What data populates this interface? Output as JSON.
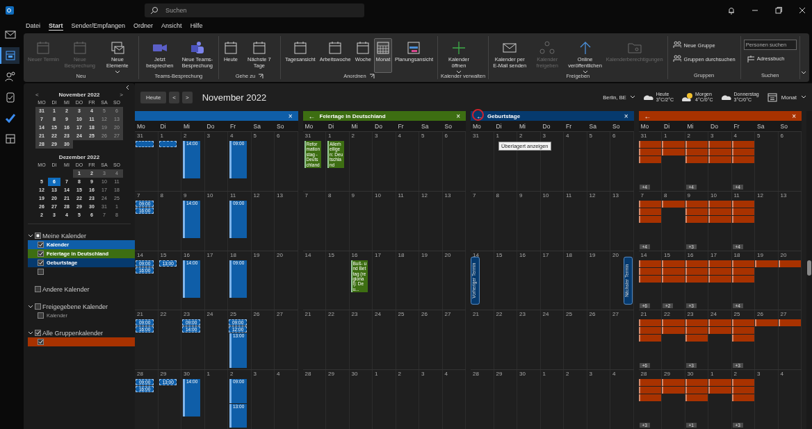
{
  "app_rail": {
    "items": [
      {
        "selected": false
      },
      {
        "selected": true
      },
      {
        "selected": false
      },
      {
        "selected": false
      },
      {
        "selected": false
      },
      {
        "selected": false
      }
    ]
  },
  "title_bar": {
    "search_placeholder": "Suchen"
  },
  "menu_tabs": [
    {
      "label": "Datei",
      "selected": false
    },
    {
      "label": "Start",
      "selected": true
    },
    {
      "label": "Sender/Empfangen",
      "selected": false
    },
    {
      "label": "Ordner",
      "selected": false
    },
    {
      "label": "Ansicht",
      "selected": false
    },
    {
      "label": "Hilfe",
      "selected": false
    }
  ],
  "ribbon": {
    "groups": [
      {
        "label": "Neu",
        "launcher": false,
        "buttons": [
          {
            "kind": "large",
            "label": "Neuer Termin",
            "disabled": true,
            "selected": false,
            "dropdown": false
          },
          {
            "kind": "large",
            "label": "Neue Besprechung",
            "disabled": true,
            "selected": false,
            "dropdown": false
          },
          {
            "kind": "large",
            "label": "Neue Elemente",
            "disabled": false,
            "selected": false,
            "dropdown": true
          }
        ]
      },
      {
        "label": "Teams-Besprechung",
        "launcher": false,
        "buttons": [
          {
            "kind": "large",
            "label": "Jetzt besprechen",
            "disabled": false,
            "selected": false,
            "dropdown": false
          },
          {
            "kind": "large",
            "label": "Neue Teams-Besprechung",
            "disabled": false,
            "selected": false,
            "dropdown": false
          }
        ]
      },
      {
        "label": "Gehe zu",
        "launcher": true,
        "buttons": [
          {
            "kind": "large",
            "label": "Heute",
            "disabled": false,
            "selected": false,
            "dropdown": false
          },
          {
            "kind": "large",
            "label": "Nächste 7 Tage",
            "disabled": false,
            "selected": false,
            "dropdown": false
          }
        ]
      },
      {
        "label": "Anordnen",
        "launcher": true,
        "buttons": [
          {
            "kind": "large",
            "label": "Tagesansicht",
            "disabled": false,
            "selected": false,
            "dropdown": false
          },
          {
            "kind": "large",
            "label": "Arbeitswoche",
            "disabled": false,
            "selected": false,
            "dropdown": false
          },
          {
            "kind": "large",
            "label": "Woche",
            "disabled": false,
            "selected": false,
            "dropdown": false
          },
          {
            "kind": "large",
            "label": "Monat",
            "disabled": false,
            "selected": true,
            "dropdown": false
          },
          {
            "kind": "large",
            "label": "Planungsansicht",
            "disabled": false,
            "selected": false,
            "dropdown": false
          }
        ]
      },
      {
        "label": "Kalender verwalten",
        "launcher": false,
        "buttons": [
          {
            "kind": "large",
            "label": "Kalender öffnen",
            "disabled": false,
            "selected": false,
            "dropdown": true
          }
        ]
      },
      {
        "label": "Freigeben",
        "launcher": false,
        "buttons": [
          {
            "kind": "large",
            "label": "Kalender per E-Mail senden",
            "disabled": false,
            "selected": false,
            "dropdown": false
          },
          {
            "kind": "large",
            "label": "Kalender freigeben",
            "disabled": true,
            "selected": false,
            "dropdown": false
          },
          {
            "kind": "large",
            "label": "Online veröffentlichen",
            "disabled": false,
            "selected": false,
            "dropdown": true
          },
          {
            "kind": "large",
            "label": "Kalenderberechtigungen",
            "disabled": true,
            "selected": false,
            "dropdown": false
          }
        ]
      },
      {
        "label": "Gruppen",
        "launcher": false,
        "buttons": [
          {
            "kind": "small",
            "label": "Neue Gruppe",
            "disabled": false,
            "selected": false,
            "dropdown": false
          },
          {
            "kind": "small",
            "label": "Gruppen durchsuchen",
            "disabled": false,
            "selected": false,
            "dropdown": false
          }
        ]
      },
      {
        "label": "Suchen",
        "launcher": false,
        "buttons": [
          {
            "kind": "field",
            "placeholder": "Personen suchen"
          },
          {
            "kind": "small",
            "label": "Adressbuch",
            "disabled": false,
            "selected": false,
            "dropdown": false
          }
        ]
      }
    ]
  },
  "mini_calendars": [
    {
      "title": "November 2022",
      "prev": "<",
      "next": ">",
      "weekdays": [
        "MO",
        "DI",
        "MI",
        "DO",
        "FR",
        "SA",
        "SO"
      ],
      "weeks": [
        [
          {
            "d": "31",
            "in_view": true,
            "selected": false
          },
          {
            "d": "1",
            "in_view": true,
            "selected": false
          },
          {
            "d": "2",
            "in_view": true,
            "selected": false
          },
          {
            "d": "3",
            "in_view": true,
            "selected": false
          },
          {
            "d": "4",
            "in_view": true,
            "selected": false
          },
          {
            "d": "5",
            "in_view": true,
            "selected": false
          },
          {
            "d": "6",
            "in_view": true,
            "selected": false
          }
        ],
        [
          {
            "d": "7",
            "in_view": true,
            "selected": false
          },
          {
            "d": "8",
            "in_view": true,
            "selected": false
          },
          {
            "d": "9",
            "in_view": true,
            "selected": false
          },
          {
            "d": "10",
            "in_view": true,
            "selected": false
          },
          {
            "d": "11",
            "in_view": true,
            "selected": false
          },
          {
            "d": "12",
            "in_view": true,
            "selected": false
          },
          {
            "d": "13",
            "in_view": true,
            "selected": false
          }
        ],
        [
          {
            "d": "14",
            "in_view": true,
            "selected": false
          },
          {
            "d": "15",
            "in_view": true,
            "selected": false
          },
          {
            "d": "16",
            "in_view": true,
            "selected": false
          },
          {
            "d": "17",
            "in_view": true,
            "selected": false
          },
          {
            "d": "18",
            "in_view": true,
            "selected": false
          },
          {
            "d": "19",
            "in_view": true,
            "selected": false
          },
          {
            "d": "20",
            "in_view": true,
            "selected": false
          }
        ],
        [
          {
            "d": "21",
            "in_view": true,
            "selected": false
          },
          {
            "d": "22",
            "in_view": true,
            "selected": false
          },
          {
            "d": "23",
            "in_view": true,
            "selected": false
          },
          {
            "d": "24",
            "in_view": true,
            "selected": false
          },
          {
            "d": "25",
            "in_view": true,
            "selected": false
          },
          {
            "d": "26",
            "in_view": true,
            "selected": false
          },
          {
            "d": "27",
            "in_view": true,
            "selected": false
          }
        ],
        [
          {
            "d": "28",
            "in_view": true,
            "selected": false
          },
          {
            "d": "29",
            "in_view": true,
            "selected": false
          },
          {
            "d": "30",
            "in_view": true,
            "selected": false
          }
        ]
      ]
    },
    {
      "title": "Dezember 2022",
      "weekdays": [
        "MO",
        "DI",
        "MI",
        "DO",
        "FR",
        "SA",
        "SO"
      ],
      "weeks": [
        [
          {
            "d": "1",
            "in_view": true,
            "selected": false
          },
          {
            "d": "2",
            "in_view": true,
            "selected": false
          },
          {
            "d": "3",
            "in_view": true,
            "selected": false
          },
          {
            "d": "4",
            "in_view": true,
            "selected": false
          }
        ],
        [
          {
            "d": "5",
            "in_view": false,
            "selected": false
          },
          {
            "d": "6",
            "in_view": false,
            "selected": true
          },
          {
            "d": "7",
            "in_view": false,
            "selected": false
          },
          {
            "d": "8",
            "in_view": false,
            "selected": false
          },
          {
            "d": "9",
            "in_view": false,
            "selected": false
          },
          {
            "d": "10",
            "in_view": false,
            "selected": false
          },
          {
            "d": "11",
            "in_view": false,
            "selected": false
          }
        ],
        [
          {
            "d": "12",
            "in_view": false,
            "selected": false
          },
          {
            "d": "13",
            "in_view": false,
            "selected": false
          },
          {
            "d": "14",
            "in_view": false,
            "selected": false
          },
          {
            "d": "15",
            "in_view": false,
            "selected": false
          },
          {
            "d": "16",
            "in_view": false,
            "selected": false
          },
          {
            "d": "17",
            "in_view": false,
            "selected": false
          },
          {
            "d": "18",
            "in_view": false,
            "selected": false
          }
        ],
        [
          {
            "d": "19",
            "in_view": false,
            "selected": false
          },
          {
            "d": "20",
            "in_view": false,
            "selected": false
          },
          {
            "d": "21",
            "in_view": false,
            "selected": false
          },
          {
            "d": "22",
            "in_view": false,
            "selected": false
          },
          {
            "d": "23",
            "in_view": false,
            "selected": false
          },
          {
            "d": "24",
            "in_view": false,
            "selected": false
          },
          {
            "d": "25",
            "in_view": false,
            "selected": false
          }
        ],
        [
          {
            "d": "26",
            "in_view": false,
            "selected": false
          },
          {
            "d": "27",
            "in_view": false,
            "selected": false
          },
          {
            "d": "28",
            "in_view": false,
            "selected": false
          },
          {
            "d": "29",
            "in_view": false,
            "selected": false
          },
          {
            "d": "30",
            "in_view": false,
            "selected": false
          },
          {
            "d": "31",
            "in_view": false,
            "selected": false
          },
          {
            "d": "1",
            "in_view": false,
            "selected": false
          }
        ],
        [
          {
            "d": "2",
            "in_view": false,
            "selected": false
          },
          {
            "d": "3",
            "in_view": false,
            "selected": false
          },
          {
            "d": "4",
            "in_view": false,
            "selected": false
          },
          {
            "d": "5",
            "in_view": false,
            "selected": false
          },
          {
            "d": "6",
            "in_view": false,
            "selected": false
          },
          {
            "d": "7",
            "in_view": false,
            "selected": false
          },
          {
            "d": "8",
            "in_view": false,
            "selected": false
          }
        ]
      ]
    }
  ],
  "calendar_groups": [
    {
      "label": "Meine Kalender",
      "expanded": true,
      "checked": false,
      "partial": true,
      "items": [
        {
          "name": "Kalender",
          "checked": true,
          "color": "#0f5ea8"
        },
        {
          "name": "Feiertage in Deutschland",
          "checked": true,
          "color": "#3d6e12"
        },
        {
          "name": "Geburtstage",
          "checked": true,
          "color": "#063a6e"
        },
        {
          "checked": false
        }
      ]
    },
    {
      "label": "Andere Kalender",
      "checked": false,
      "partial": false
    },
    {
      "label": "Freigegebene Kalender",
      "expanded": true,
      "checked": false,
      "partial": false,
      "items": [
        {
          "name": "Kalender",
          "checked": false
        }
      ]
    },
    {
      "label": "Alle Gruppenkalender",
      "expanded": true,
      "checked": true,
      "partial": false,
      "items": [
        {
          "checked": true,
          "color": "#a83200"
        }
      ]
    }
  ],
  "toolbar": {
    "today": "Heute",
    "prev": "<",
    "next": ">",
    "title": "November 2022",
    "location": "Berlin, BE",
    "weather": [
      {
        "kind": "cloudy",
        "day": "Heute",
        "temps": "3°C/2°C"
      },
      {
        "kind": "sunny",
        "day": "Morgen",
        "temps": "4°C/0°C"
      },
      {
        "kind": "cloudy",
        "day": "Donnerstag",
        "temps": "3°C/0°C"
      }
    ],
    "view": "Monat"
  },
  "panes": [
    {
      "color": "#0f5ea8",
      "close": "×",
      "weekdays": [
        "Mo",
        "Di",
        "Mi",
        "Do",
        "Fr",
        "Sa",
        "So"
      ],
      "weeks": [
        [
          {
            "d": "31",
            "events": [
              {
                "kind": "tentative"
              }
            ]
          },
          {
            "d": "1",
            "events": [
              {
                "kind": "tentative"
              }
            ]
          },
          {
            "d": "2",
            "events": [
              {
                "kind": "busy",
                "time": "14:00"
              }
            ]
          },
          {
            "d": "3"
          },
          {
            "d": "4",
            "events": [
              {
                "kind": "busy",
                "time": "09:00"
              }
            ]
          },
          {
            "d": "5"
          },
          {
            "d": "6"
          }
        ],
        [
          {
            "d": "7",
            "events": [
              {
                "kind": "tentative",
                "time": "09:00"
              },
              {
                "kind": "tentative",
                "time": "16:00"
              }
            ]
          },
          {
            "d": "8"
          },
          {
            "d": "9",
            "events": [
              {
                "kind": "busy",
                "time": "14:00"
              }
            ]
          },
          {
            "d": "10"
          },
          {
            "d": "11",
            "events": [
              {
                "kind": "busy",
                "time": "09:00"
              }
            ]
          },
          {
            "d": "12"
          },
          {
            "d": "13"
          }
        ],
        [
          {
            "d": "14",
            "events": [
              {
                "kind": "tentative",
                "time": "09:00"
              },
              {
                "kind": "tentative",
                "time": "16:00"
              }
            ]
          },
          {
            "d": "15",
            "events": [
              {
                "kind": "tentative",
                "time": "13:00"
              }
            ]
          },
          {
            "d": "16",
            "events": [
              {
                "kind": "busy",
                "time": "14:00"
              }
            ]
          },
          {
            "d": "17"
          },
          {
            "d": "18",
            "events": [
              {
                "kind": "busy",
                "time": "09:00"
              }
            ]
          },
          {
            "d": "19"
          },
          {
            "d": "20"
          }
        ],
        [
          {
            "d": "21",
            "events": [
              {
                "kind": "tentative",
                "time": "09:00"
              },
              {
                "kind": "tentative",
                "time": "16:00"
              }
            ]
          },
          {
            "d": "22"
          },
          {
            "d": "23",
            "events": [
              {
                "kind": "tentative",
                "time": "09:00"
              },
              {
                "kind": "tentative",
                "time": "14:00"
              }
            ]
          },
          {
            "d": "24"
          },
          {
            "d": "25",
            "events": [
              {
                "kind": "tentative",
                "time": "09:00"
              },
              {
                "kind": "tentative",
                "time": "12:00"
              },
              {
                "kind": "busy",
                "time": "13:00"
              }
            ]
          },
          {
            "d": "26"
          },
          {
            "d": "27"
          }
        ],
        [
          {
            "d": "28",
            "events": [
              {
                "kind": "tentative",
                "time": "09:00"
              },
              {
                "kind": "tentative",
                "time": "16:00"
              }
            ]
          },
          {
            "d": "29",
            "events": [
              {
                "kind": "tentative",
                "time": "13:00"
              }
            ]
          },
          {
            "d": "30",
            "events": [
              {
                "kind": "busy",
                "time": "14:00"
              }
            ]
          },
          {
            "d": "1"
          },
          {
            "d": "2",
            "events": [
              {
                "kind": "busy",
                "time": "09:00"
              },
              {
                "kind": "busy",
                "time": "13:00"
              }
            ]
          },
          {
            "d": "3"
          },
          {
            "d": "4"
          }
        ]
      ]
    },
    {
      "title": "Feiertage in Deutschland",
      "back": "←",
      "color": "#3d6e12",
      "close": "×",
      "weekdays": [
        "Mo",
        "Di",
        "Mi",
        "Do",
        "Fr",
        "Sa",
        "So"
      ],
      "weeks": [
        [
          {
            "d": "31",
            "events": [
              {
                "kind": "holiday",
                "title": "Reformationstag - Deutschland"
              }
            ]
          },
          {
            "d": "1",
            "events": [
              {
                "kind": "holiday",
                "title": "Allerheiligen: Deutschland"
              }
            ]
          },
          {
            "d": "2"
          },
          {
            "d": "3"
          },
          {
            "d": "4"
          },
          {
            "d": "5"
          },
          {
            "d": "6"
          }
        ],
        [
          {
            "d": "7"
          },
          {
            "d": "8"
          },
          {
            "d": "9"
          },
          {
            "d": "10"
          },
          {
            "d": "11"
          },
          {
            "d": "12"
          },
          {
            "d": "13"
          }
        ],
        [
          {
            "d": "14"
          },
          {
            "d": "15"
          },
          {
            "d": "16",
            "events": [
              {
                "kind": "holiday",
                "title": "Buß- und Bettag (regional): Deu..."
              }
            ]
          },
          {
            "d": "17"
          },
          {
            "d": "18"
          },
          {
            "d": "19"
          },
          {
            "d": "20"
          }
        ],
        [
          {
            "d": "21"
          },
          {
            "d": "22"
          },
          {
            "d": "23"
          },
          {
            "d": "24"
          },
          {
            "d": "25"
          },
          {
            "d": "26"
          },
          {
            "d": "27"
          }
        ],
        [
          {
            "d": "28"
          },
          {
            "d": "29"
          },
          {
            "d": "30"
          },
          {
            "d": "1"
          },
          {
            "d": "2"
          },
          {
            "d": "3"
          },
          {
            "d": "4"
          }
        ]
      ]
    },
    {
      "title": "Geburtstage",
      "back": "←",
      "tooltip": "Überlagert anzeigen",
      "prev_appointment": "Vorheriger Termin",
      "next_appointment": "Nächster Termin",
      "color": "#063a6e",
      "close": "×",
      "weekdays": [
        "Mo",
        "Di",
        "Mi",
        "Do",
        "Fr",
        "Sa",
        "So"
      ],
      "weeks": [
        [
          {
            "d": "31"
          },
          {
            "d": "1"
          },
          {
            "d": "2"
          },
          {
            "d": "3"
          },
          {
            "d": "4"
          },
          {
            "d": "5"
          },
          {
            "d": "6"
          }
        ],
        [
          {
            "d": "7"
          },
          {
            "d": "8"
          },
          {
            "d": "9"
          },
          {
            "d": "10"
          },
          {
            "d": "11"
          },
          {
            "d": "12"
          },
          {
            "d": "13"
          }
        ],
        [
          {
            "d": "14"
          },
          {
            "d": "15"
          },
          {
            "d": "16"
          },
          {
            "d": "17"
          },
          {
            "d": "18"
          },
          {
            "d": "19"
          },
          {
            "d": "20"
          }
        ],
        [
          {
            "d": "21"
          },
          {
            "d": "22"
          },
          {
            "d": "23"
          },
          {
            "d": "24"
          },
          {
            "d": "25"
          },
          {
            "d": "26"
          },
          {
            "d": "27"
          }
        ],
        [
          {
            "d": "28"
          },
          {
            "d": "29"
          },
          {
            "d": "30"
          },
          {
            "d": "1"
          },
          {
            "d": "2"
          },
          {
            "d": "3"
          },
          {
            "d": "4"
          }
        ]
      ]
    },
    {
      "back": "←",
      "color": "#a83200",
      "close": "×",
      "weekdays": [
        "Mo",
        "Di",
        "Mi",
        "Do",
        "Fr",
        "Sa",
        "So"
      ],
      "weeks": [
        [
          {
            "d": "31",
            "events": [
              {
                "kind": "bar"
              },
              {
                "kind": "bar"
              },
              {
                "kind": "bar"
              }
            ],
            "more": "+4"
          },
          {
            "d": "1",
            "events": [
              {
                "kind": "bar"
              },
              {
                "kind": "bar"
              }
            ]
          },
          {
            "d": "2",
            "events": [
              {
                "kind": "bar"
              },
              {
                "kind": "bar"
              },
              {
                "kind": "bar"
              }
            ],
            "more": "+4"
          },
          {
            "d": "3",
            "events": [
              {
                "kind": "bar"
              },
              {
                "kind": "bar"
              },
              {
                "kind": "bar"
              }
            ]
          },
          {
            "d": "4",
            "events": [
              {
                "kind": "bar"
              },
              {
                "kind": "bar"
              },
              {
                "kind": "bar"
              }
            ],
            "more": "+4"
          },
          {
            "d": "5"
          },
          {
            "d": "6"
          }
        ],
        [
          {
            "d": "7",
            "events": [
              {
                "kind": "bar"
              },
              {
                "kind": "bar"
              },
              {
                "kind": "bar"
              }
            ],
            "more": "+4"
          },
          {
            "d": "8",
            "events": [
              {
                "kind": "bar"
              }
            ]
          },
          {
            "d": "9",
            "events": [
              {
                "kind": "bar"
              },
              {
                "kind": "bar"
              },
              {
                "kind": "bar"
              }
            ],
            "more": "+3"
          },
          {
            "d": "10",
            "events": [
              {
                "kind": "bar"
              },
              {
                "kind": "bar"
              },
              {
                "kind": "bar"
              }
            ]
          },
          {
            "d": "11",
            "events": [
              {
                "kind": "bar"
              },
              {
                "kind": "bar"
              },
              {
                "kind": "bar"
              }
            ],
            "more": "+4"
          },
          {
            "d": "12"
          },
          {
            "d": "13"
          }
        ],
        [
          {
            "d": "14",
            "events": [
              {
                "kind": "bar"
              },
              {
                "kind": "bar"
              },
              {
                "kind": "bar"
              }
            ],
            "more": "+6"
          },
          {
            "d": "15",
            "events": [
              {
                "kind": "bar"
              },
              {
                "kind": "bar"
              },
              {
                "kind": "bar"
              }
            ],
            "more": "+2"
          },
          {
            "d": "16",
            "events": [
              {
                "kind": "bar"
              },
              {
                "kind": "bar"
              },
              {
                "kind": "bar"
              }
            ],
            "more": "+3"
          },
          {
            "d": "17",
            "events": [
              {
                "kind": "bar"
              },
              {
                "kind": "bar"
              },
              {
                "kind": "bar"
              }
            ]
          },
          {
            "d": "18",
            "events": [
              {
                "kind": "bar"
              },
              {
                "kind": "bar"
              },
              {
                "kind": "bar"
              }
            ],
            "more": "+4"
          },
          {
            "d": "19",
            "events": [
              {
                "kind": "bar"
              }
            ]
          },
          {
            "d": "20",
            "events": [
              {
                "kind": "bar"
              }
            ]
          }
        ],
        [
          {
            "d": "21",
            "events": [
              {
                "kind": "bar"
              },
              {
                "kind": "bar"
              },
              {
                "kind": "bar"
              }
            ],
            "more": "+6"
          },
          {
            "d": "22",
            "events": [
              {
                "kind": "bar"
              },
              {
                "kind": "bar"
              }
            ]
          },
          {
            "d": "23",
            "events": [
              {
                "kind": "bar"
              },
              {
                "kind": "bar"
              },
              {
                "kind": "bar"
              }
            ],
            "more": "+3"
          },
          {
            "d": "24",
            "events": [
              {
                "kind": "bar"
              },
              {
                "kind": "bar"
              }
            ]
          },
          {
            "d": "25",
            "events": [
              {
                "kind": "bar"
              },
              {
                "kind": "bar"
              },
              {
                "kind": "bar"
              }
            ],
            "more": "+3"
          },
          {
            "d": "26",
            "events": [
              {
                "kind": "bar"
              }
            ]
          },
          {
            "d": "27",
            "events": [
              {
                "kind": "bar"
              }
            ]
          }
        ],
        [
          {
            "d": "28",
            "events": [
              {
                "kind": "bar"
              },
              {
                "kind": "bar"
              },
              {
                "kind": "bar"
              }
            ],
            "more": "+3"
          },
          {
            "d": "29",
            "events": [
              {
                "kind": "bar"
              },
              {
                "kind": "bar"
              }
            ]
          },
          {
            "d": "30",
            "events": [
              {
                "kind": "bar"
              },
              {
                "kind": "bar"
              },
              {
                "kind": "bar"
              }
            ],
            "more": "+1"
          },
          {
            "d": "1",
            "events": [
              {
                "kind": "bar"
              },
              {
                "kind": "bar"
              }
            ]
          },
          {
            "d": "2",
            "events": [
              {
                "kind": "bar"
              },
              {
                "kind": "bar"
              },
              {
                "kind": "bar"
              }
            ],
            "more": "+3"
          },
          {
            "d": "3"
          },
          {
            "d": "4"
          }
        ]
      ]
    }
  ]
}
